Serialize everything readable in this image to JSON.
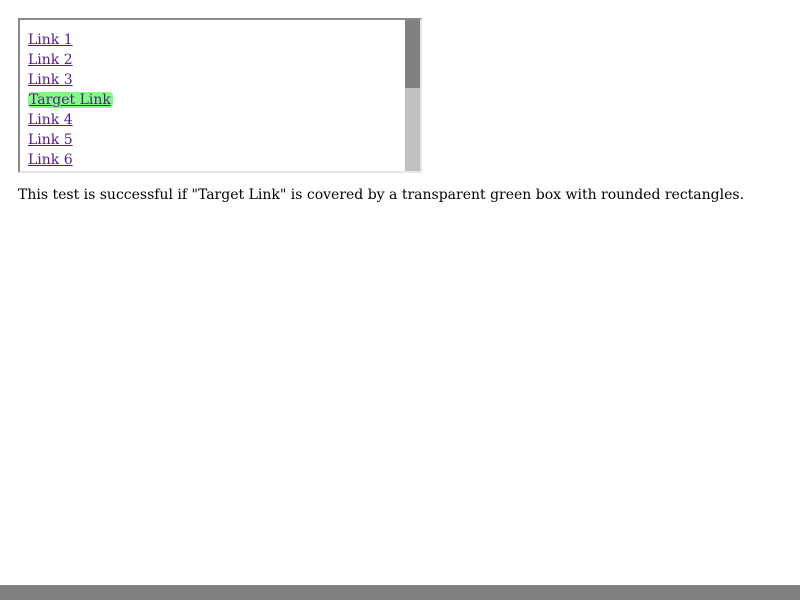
{
  "links": [
    {
      "label": "Link 1"
    },
    {
      "label": "Link 2"
    },
    {
      "label": "Link 3"
    },
    {
      "label": "Target Link"
    },
    {
      "label": "Link 4"
    },
    {
      "label": "Link 5"
    },
    {
      "label": "Link 6"
    }
  ],
  "note": "This test is successful if \"Target Link\" is covered by a transparent green box with rounded rectangles.",
  "colors": {
    "link": "#551a8b",
    "highlight": "rgba(0,255,0,0.5)",
    "scrollbar_track": "#c0c0c0",
    "scrollbar_thumb": "#808080",
    "bottom_bar": "#808080"
  }
}
